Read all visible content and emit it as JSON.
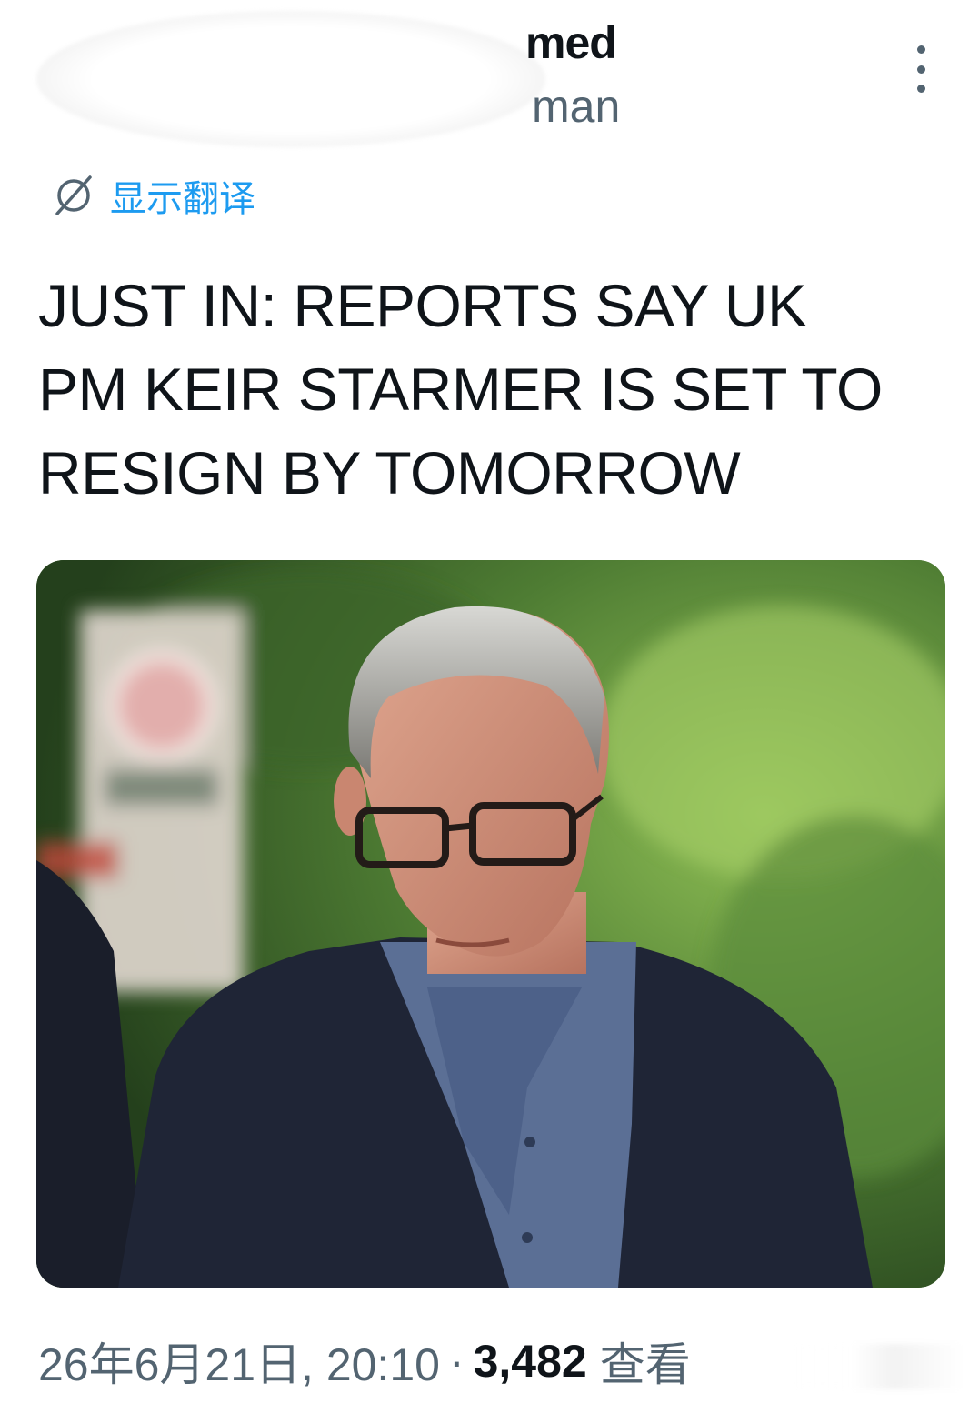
{
  "author": {
    "display_name": "med",
    "handle": "man"
  },
  "translate": {
    "label": "显示翻译",
    "icon": "globe-slash-icon"
  },
  "tweet": {
    "lines": [
      "JUST IN: REPORTS SAY UK",
      "PM KEIR STARMER IS SET TO",
      "RESIGN BY TOMORROW"
    ]
  },
  "meta": {
    "timestamp": "26年6月21日, 20:10",
    "separator": "·",
    "views_count": "3,482",
    "views_label": "查看"
  },
  "colors": {
    "accent": "#1d9bf0",
    "text": "#0f1419",
    "secondary": "#536471"
  },
  "icons": {
    "more": "more-vertical-icon"
  }
}
